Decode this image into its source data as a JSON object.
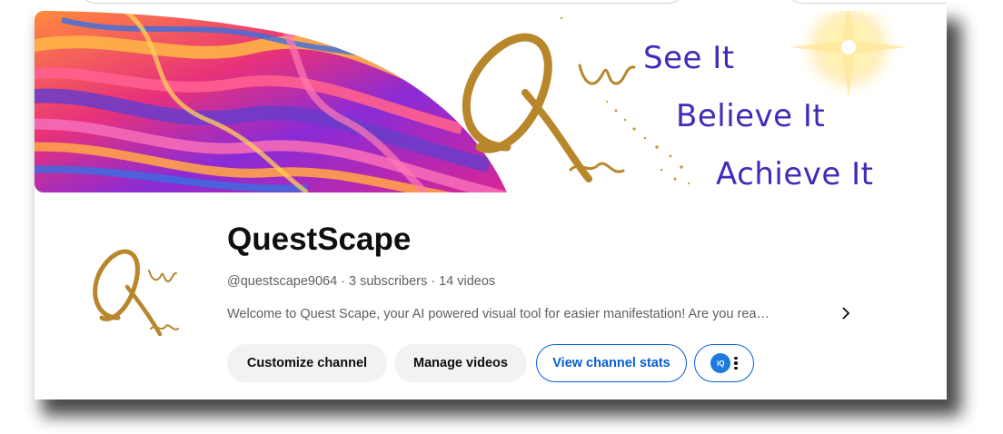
{
  "banner": {
    "taglines": [
      "See It",
      "Believe It",
      "Achieve It"
    ]
  },
  "channel": {
    "name": "QuestScape",
    "handle": "@questscape9064",
    "subscribers": "3 subscribers",
    "videos": "14 videos",
    "separator": "·",
    "description": "Welcome to Quest Scape, your AI powered visual tool for easier manifestation! Are you rea…"
  },
  "actions": {
    "customize_label": "Customize channel",
    "manage_label": "Manage videos",
    "stats_label": "View channel stats",
    "extension_logo_text": "iQ"
  },
  "icons": {
    "description_more": "chevron-right-icon",
    "extension_menu": "more-vert-icon",
    "banner_sparkle": "star-sparkle-icon"
  },
  "colors": {
    "tagline": "#3e2cb8",
    "gold": "#b8862b",
    "link_blue": "#065fd4",
    "chip_bg": "#f2f2f2"
  }
}
